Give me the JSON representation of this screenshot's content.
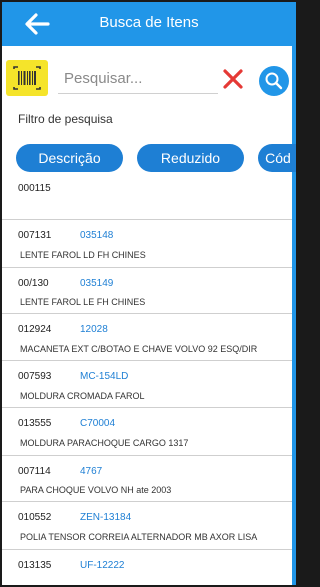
{
  "header": {
    "title": "Busca de Itens"
  },
  "search": {
    "placeholder": "Pesquisar...",
    "value": ""
  },
  "filter": {
    "label": "Filtro de pesquisa"
  },
  "chips": [
    "Descrição",
    "Reduzido",
    "Cód"
  ],
  "items": [
    {
      "code": "000115",
      "ref": "",
      "description": ""
    },
    {
      "code": "007131",
      "ref": "035148",
      "description": "LENTE FAROL LD FH CHINES"
    },
    {
      "code": "00/130",
      "ref": "035149",
      "description": "LENTE FAROL LE FH CHINES"
    },
    {
      "code": "012924",
      "ref": "12028",
      "description": "MACANETA EXT C/BOTAO E CHAVE VOLVO 92 ESQ/DIR"
    },
    {
      "code": "007593",
      "ref": "MC-154LD",
      "description": "MOLDURA  CROMADA FAROL"
    },
    {
      "code": "013555",
      "ref": "C70004",
      "description": "MOLDURA  PARACHOQUE CARGO 1317"
    },
    {
      "code": "007114",
      "ref": "4767",
      "description": "PARA CHOQUE VOLVO NH ate 2003"
    },
    {
      "code": "010552",
      "ref": "ZEN-13184",
      "description": "POLIA TENSOR CORREIA ALTERNADOR MB AXOR LISA"
    },
    {
      "code": "013135",
      "ref": "UF-12222",
      "description": ""
    }
  ],
  "colors": {
    "primary": "#2196e8",
    "chip": "#1e7fd4",
    "barcode_bg": "#f5e42a",
    "clear": "#e53935"
  },
  "icons": {
    "back": "arrow-left-icon",
    "barcode": "barcode-icon",
    "clear": "close-icon",
    "search": "search-icon"
  }
}
